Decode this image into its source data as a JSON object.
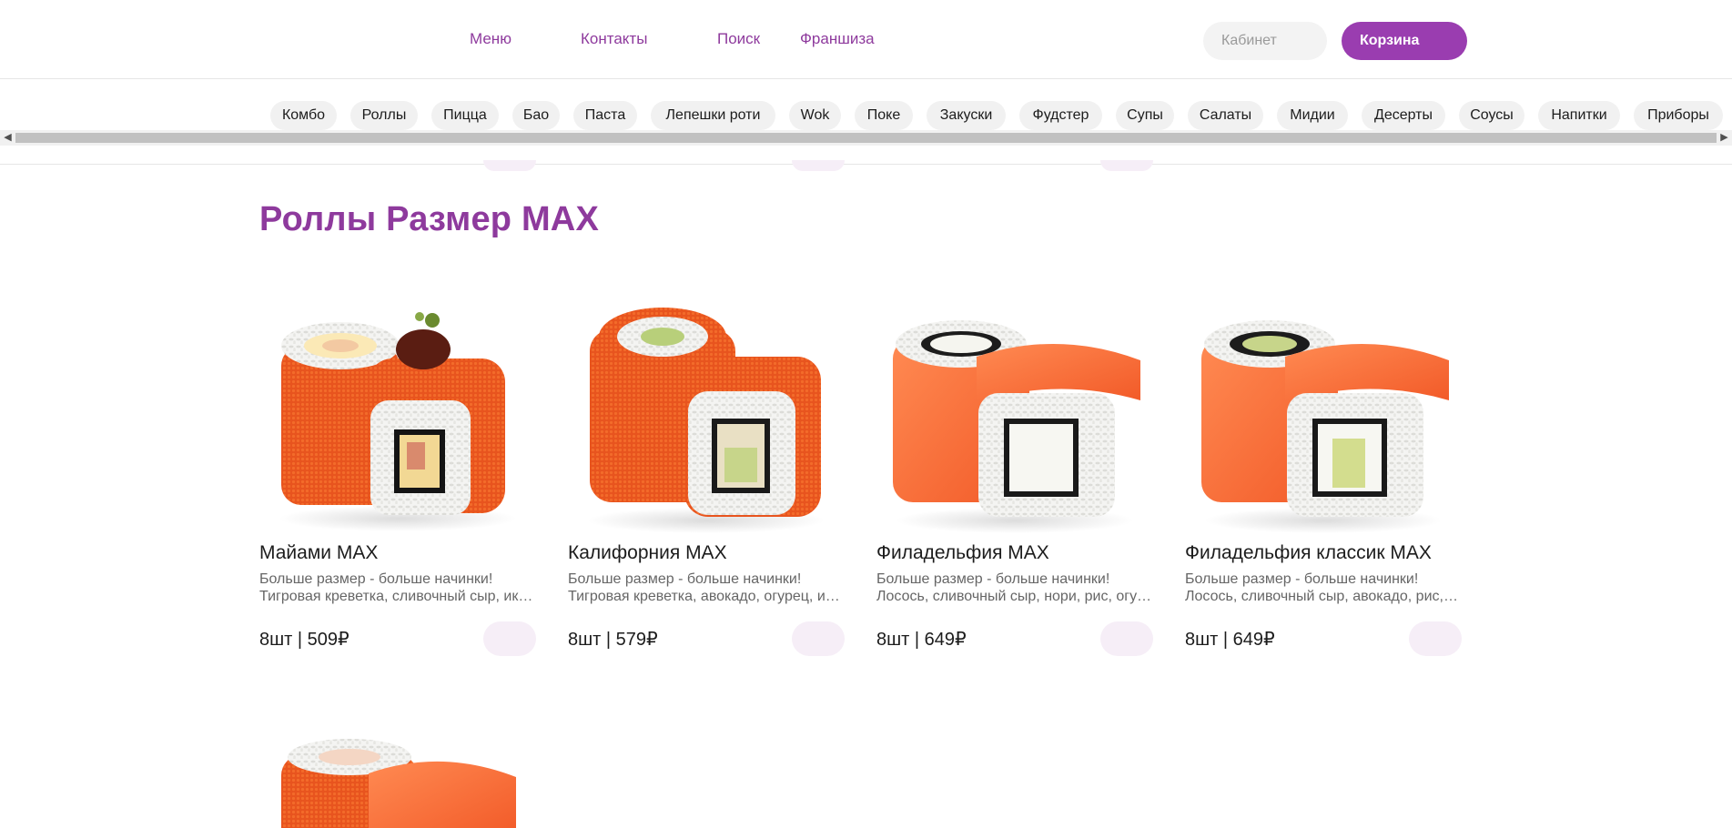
{
  "header": {
    "nav": [
      "Меню",
      "Контакты",
      "Поиск",
      "Франшиза"
    ],
    "cabinet_placeholder": "Кабинет",
    "cart_label": "Корзина"
  },
  "categories": [
    "Комбо",
    "Роллы",
    "Пицца",
    "Бао",
    "Паста",
    "Лепешки роти",
    "Wok",
    "Поке",
    "Закуски",
    "Фудстер",
    "Супы",
    "Салаты",
    "Мидии",
    "Десерты",
    "Соусы",
    "Напитки",
    "Приборы"
  ],
  "section": {
    "title": "Роллы Размер MAX",
    "products": [
      {
        "name": "Майами MAX",
        "desc1": "Больше размер - больше начинки!",
        "desc2": "Тигровая креветка, сливочный сыр, икра тобико, рис, нори",
        "price": "8шт | 509₽"
      },
      {
        "name": "Калифорния MAX",
        "desc1": "Больше размер - больше начинки!",
        "desc2": "Тигровая креветка, авокадо, огурец, икра тобико, рис, нори",
        "price": "8шт | 579₽"
      },
      {
        "name": "Филадельфия MAX",
        "desc1": "Больше размер - больше начинки!",
        "desc2": "Лосось, сливочный сыр, нори, рис, огурец",
        "price": "8шт | 649₽"
      },
      {
        "name": "Филадельфия классик MAX",
        "desc1": "Больше размер - больше начинки!",
        "desc2": "Лосось, сливочный сыр, авокадо, рис, нори",
        "price": "8шт | 649₽"
      }
    ]
  },
  "colors": {
    "accent": "#9a3db0",
    "title": "#8e3a9d",
    "chip_bg": "#f1f1f1",
    "btn_bg": "#f6eef7"
  },
  "icons": [
    "scroll-left-arrow-icon",
    "scroll-right-arrow-icon"
  ]
}
